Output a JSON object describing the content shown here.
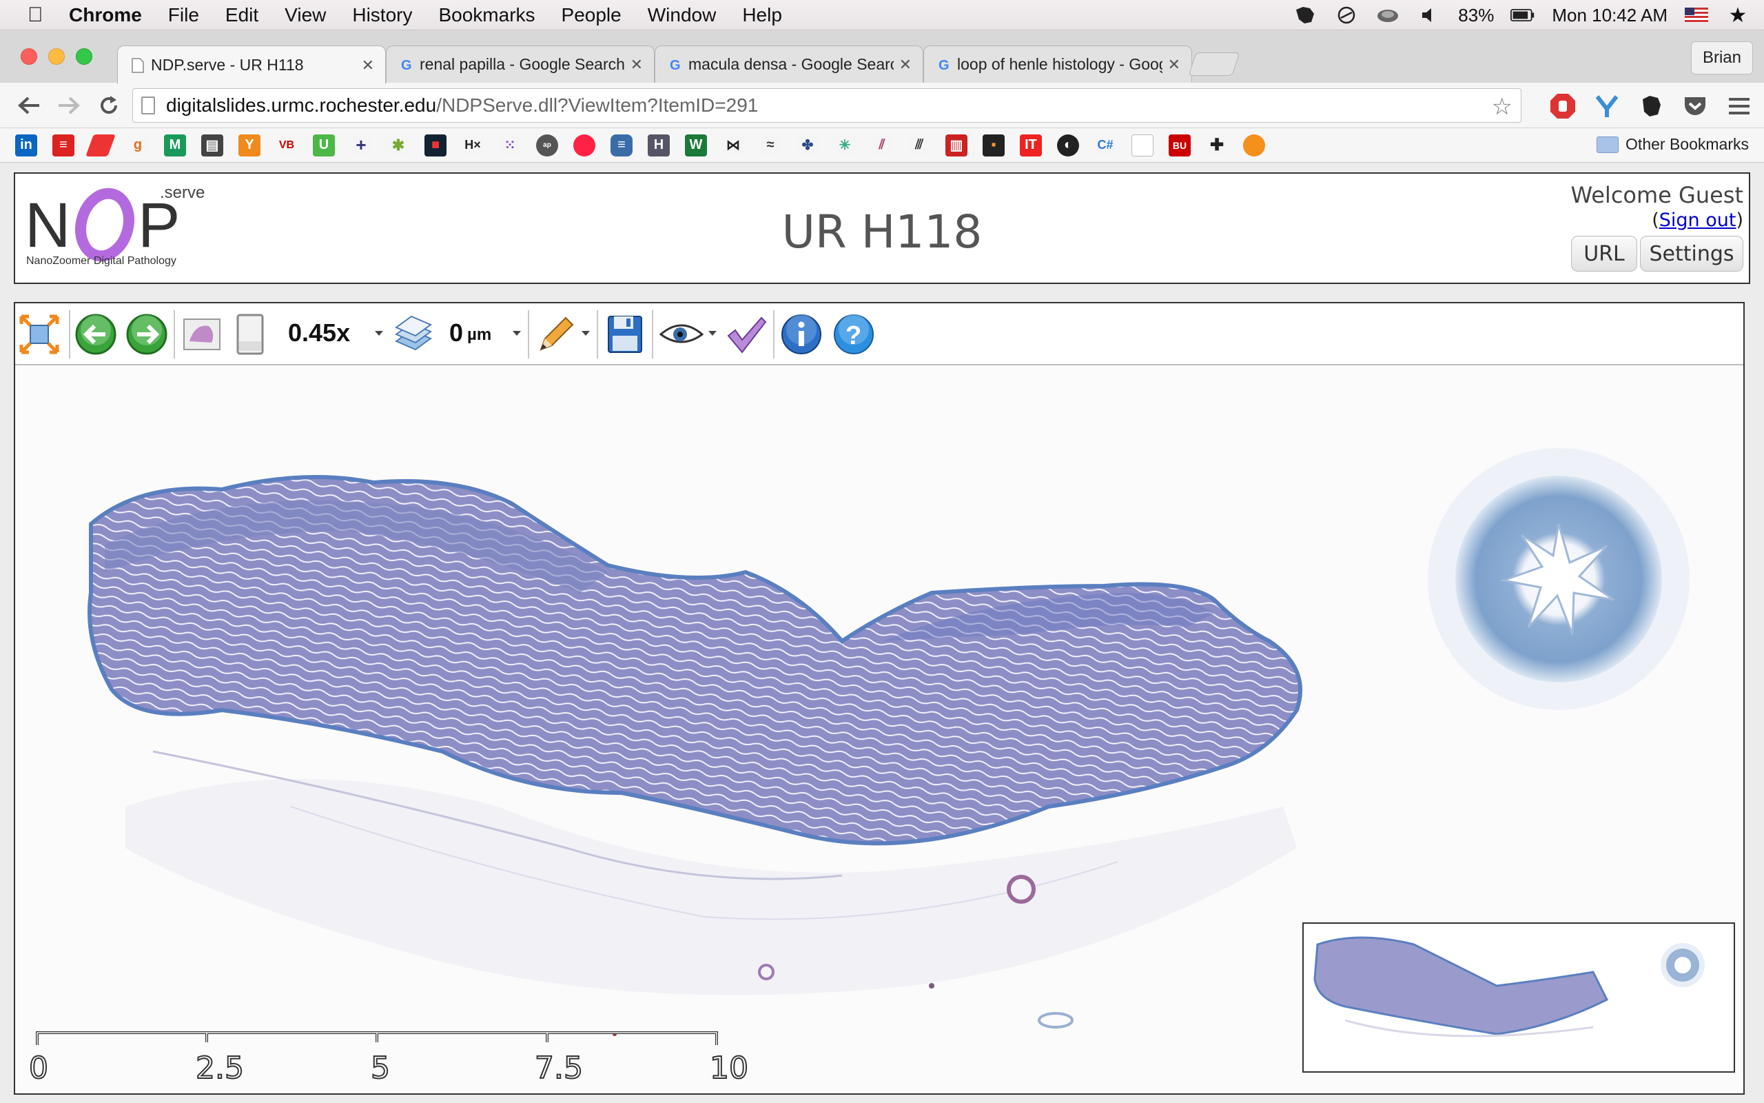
{
  "menubar": {
    "app": "Chrome",
    "items": [
      "File",
      "Edit",
      "View",
      "History",
      "Bookmarks",
      "People",
      "Window",
      "Help"
    ],
    "battery": "83%",
    "clock": "Mon 10:42 AM"
  },
  "browser": {
    "tabs": [
      {
        "title": "NDP.serve - UR H118",
        "favicon": "page-icon",
        "active": true
      },
      {
        "title": "renal papilla - Google Search",
        "favicon": "google-icon",
        "active": false
      },
      {
        "title": "macula densa - Google Search",
        "favicon": "google-icon",
        "active": false
      },
      {
        "title": "loop of henle histology - Google Search",
        "favicon": "google-icon",
        "active": false
      }
    ],
    "profile": "Brian",
    "url_host": "digitalslides.urmc.rochester.edu",
    "url_path": "/NDPServe.dll?ViewItem?ItemID=291",
    "other_bookmarks": "Other Bookmarks"
  },
  "header": {
    "logo_serve": ".serve",
    "logo_subtitle": "NanoZoomer Digital Pathology",
    "title": "UR H118",
    "welcome": "Welcome Guest",
    "signout_prefix": "(",
    "signout": "Sign out",
    "signout_suffix": ")",
    "url_button": "URL",
    "settings_button": "Settings"
  },
  "viewer": {
    "zoom": "0.45x",
    "focus_value": "0",
    "focus_unit": "µm",
    "scale_labels": [
      "0",
      "2.5",
      "5",
      "7.5",
      "10 mm"
    ]
  },
  "colors": {
    "tissue": "#8f8fc8",
    "tissue_edge": "#5a7fc0",
    "accent_green": "#3aa33a",
    "accent_blue": "#2d6fc4"
  }
}
